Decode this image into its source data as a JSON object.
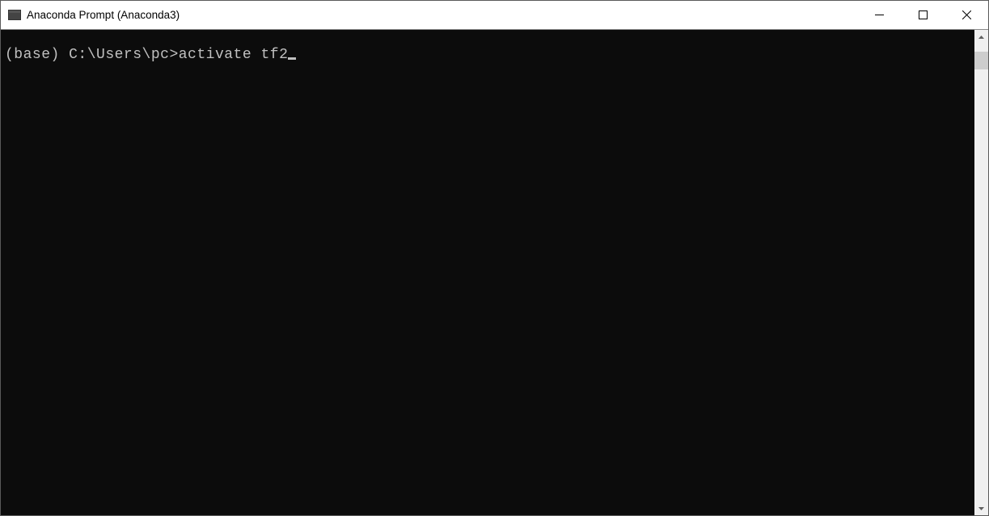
{
  "window": {
    "title": "Anaconda Prompt (Anaconda3)"
  },
  "terminal": {
    "prompt_env": "(base) ",
    "prompt_path": "C:\\Users\\pc>",
    "command": "activate tf2"
  }
}
